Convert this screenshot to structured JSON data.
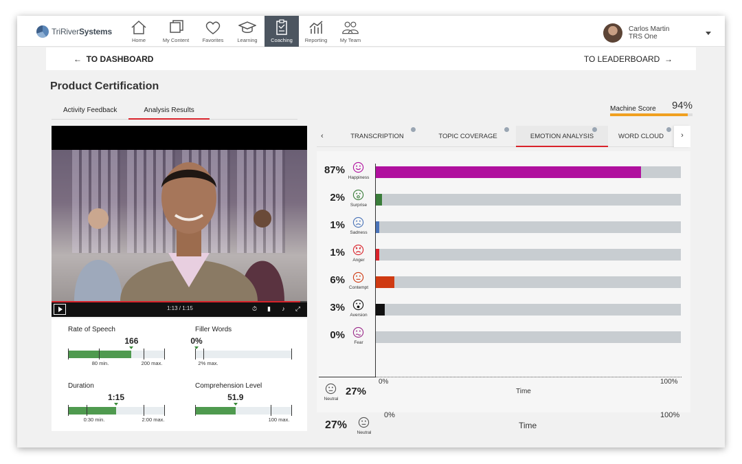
{
  "brand": {
    "name_light": "TriRiver",
    "name_bold": "Systems"
  },
  "nav": [
    {
      "label": "Home",
      "icon": "home-icon",
      "active": false
    },
    {
      "label": "My Content",
      "icon": "content-icon",
      "active": false
    },
    {
      "label": "Favorites",
      "icon": "heart-icon",
      "active": false
    },
    {
      "label": "Learning",
      "icon": "graduation-cap-icon",
      "active": false
    },
    {
      "label": "Coaching",
      "icon": "clipboard-icon",
      "active": true
    },
    {
      "label": "Reporting",
      "icon": "bar-chart-icon",
      "active": false
    },
    {
      "label": "My Team",
      "icon": "team-icon",
      "active": false
    }
  ],
  "user": {
    "name": "Carlos Martin",
    "org": "TRS One"
  },
  "subbar": {
    "back": "TO DASHBOARD",
    "forward": "TO LEADERBOARD"
  },
  "page": {
    "title": "Product Certification"
  },
  "subtabs": [
    {
      "label": "Activity Feedback",
      "active": false
    },
    {
      "label": "Analysis Results",
      "active": true
    }
  ],
  "machine_score": {
    "label": "Machine Score",
    "value": "94%",
    "fraction": 0.94,
    "color": "#f0a020"
  },
  "video": {
    "time": "1:13 / 1:15",
    "progress": 0.973
  },
  "metrics": {
    "rate_of_speech": {
      "label": "Rate of Speech",
      "value": "166",
      "min": "80 min.",
      "max": "200 max.",
      "level": 0.66
    },
    "filler_words": {
      "label": "Filler Words",
      "value": "0%",
      "max": "2% max.",
      "level": 0.0
    },
    "duration": {
      "label": "Duration",
      "value": "1:15",
      "min": "0:30 min.",
      "max": "2:00 max.",
      "level": 0.5
    },
    "comprehension": {
      "label": "Comprehension Level",
      "value": "51.9",
      "max": "100 max.",
      "level": 0.42
    }
  },
  "analysis_tabs": [
    {
      "label": "TRANSCRIPTION",
      "active": false
    },
    {
      "label": "TOPIC COVERAGE",
      "active": false
    },
    {
      "label": "EMOTION ANALYSIS",
      "active": true
    },
    {
      "label": "WORD CLOUD",
      "active": false
    }
  ],
  "chart_data": {
    "type": "bar",
    "orientation": "horizontal",
    "categories": [
      "Happiness",
      "Surprise",
      "Sadness",
      "Anger",
      "Contempt",
      "Aversion",
      "Fear"
    ],
    "values": [
      87,
      2,
      1,
      1,
      6,
      3,
      0
    ],
    "value_labels": [
      "87%",
      "2%",
      "1%",
      "1%",
      "6%",
      "3%",
      "0%"
    ],
    "colors": [
      "#b0109e",
      "#3a7d3a",
      "#4a73b8",
      "#d9222a",
      "#cf3a12",
      "#111111",
      "#9a2a8a"
    ],
    "xlim": [
      0,
      100
    ],
    "x_tick_labels": [
      "0%",
      "100%"
    ],
    "xlabel": "Time",
    "neutral": {
      "label": "Neutral",
      "value": "27%"
    }
  }
}
